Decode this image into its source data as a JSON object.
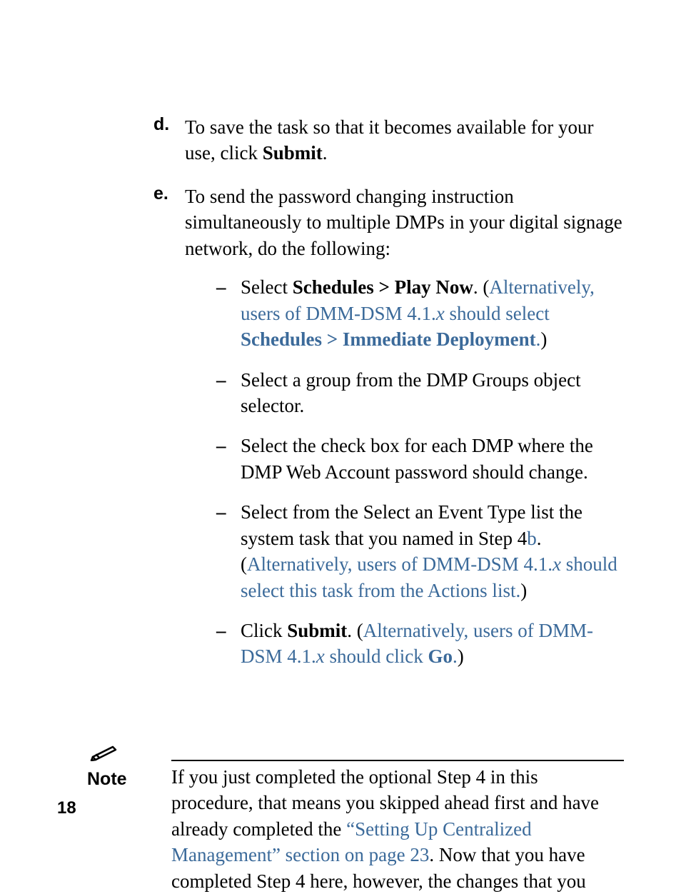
{
  "items": {
    "d": {
      "label": "d.",
      "text_pre": "To save the task so that it becomes available for your use, click ",
      "bold": "Submit",
      "text_post": "."
    },
    "e": {
      "label": "e.",
      "intro": "To send the password changing instruction simultaneously to multiple DMPs in your digital signage network, do the following:",
      "subs": {
        "s1": {
          "dash": "–",
          "pre": "Select ",
          "bold": "Schedules > Play Now",
          "post": ". (",
          "alt_pre": "Alternatively, users of DMM-DSM 4.1.",
          "alt_italic": "x",
          "alt_mid": " should select ",
          "alt_bold": "Schedules > Immediate Deployment",
          "alt_post": ".",
          "close": ")"
        },
        "s2": {
          "dash": "–",
          "text": "Select a group from the DMP Groups object selector."
        },
        "s3": {
          "dash": "–",
          "text": "Select the check box for each DMP where the DMP Web Account password should change."
        },
        "s4": {
          "dash": "–",
          "pre": "Select from the Select an Event Type list the system task that you named in Step 4",
          "step_ref": "b",
          "post": ". (",
          "alt_pre": "Alternatively, users of DMM-DSM 4.1.",
          "alt_italic": "x",
          "alt_mid": " should select this task from the Actions list.",
          "close": ")"
        },
        "s5": {
          "dash": "–",
          "pre": "Click ",
          "bold": "Submit",
          "post": ". (",
          "alt_pre": "Alternatively, users of DMM-DSM 4.1.",
          "alt_italic": "x",
          "alt_mid": " should click ",
          "alt_bold": "Go",
          "alt_post": ".",
          "close": ")"
        }
      }
    }
  },
  "note": {
    "label": "Note",
    "body_pre": "If you just completed the optional Step 4 in this procedure, that means you skipped ahead first and have already completed the ",
    "link": "“Setting Up Centralized Management” section on page 23",
    "body_post": ". Now that you have completed Step 4 here, however, the changes that you"
  },
  "pageNumber": "18"
}
